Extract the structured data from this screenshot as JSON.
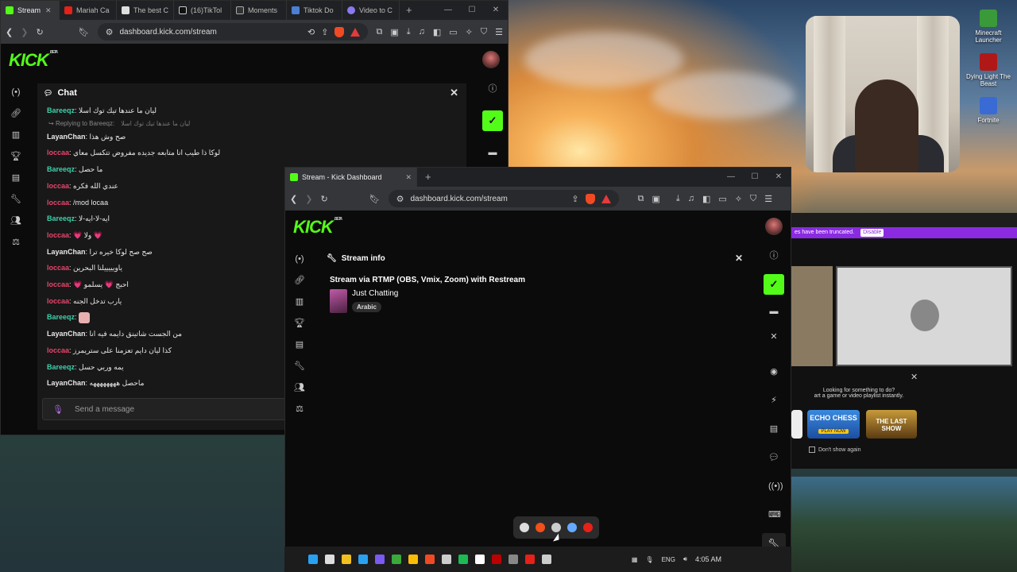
{
  "desktop": {
    "icons": [
      {
        "label": "Minecraft Launcher",
        "color": "#3a9a3a"
      },
      {
        "label": "Dying Light The Beast",
        "color": "#b01818"
      },
      {
        "label": "Fortnite",
        "color": "#3a6ad4"
      }
    ]
  },
  "back_window": {
    "banner_text": "es have been truncated.",
    "banner_button": "Disable",
    "suggest_line1": "Looking for something to do?",
    "suggest_line2": "art a game or video playlist instantly.",
    "game1": "ECHO CHESS",
    "game1_sub": "PLAY NOW",
    "game2": "THE LAST SHOW",
    "dont_show": "Don't show again"
  },
  "win1": {
    "tabs": [
      {
        "label": "Stream",
        "color": "#53fc18",
        "active": true
      },
      {
        "label": "Mariah Ca",
        "color": "#e62117"
      },
      {
        "label": "The best C",
        "color": "#dddddd"
      },
      {
        "label": "(16)TikTol",
        "color": "#111111"
      },
      {
        "label": "Moments",
        "color": "#333333"
      },
      {
        "label": "Tiktok Do",
        "color": "#4a7fd4"
      },
      {
        "label": "Video to C",
        "color": "#8a7af0"
      }
    ],
    "url": "dashboard.kick.com/stream",
    "logo": "KICK",
    "beta": "BETA",
    "chat": {
      "title": "Chat",
      "messages": [
        {
          "user": "Bareeqz",
          "color": "#3fd0a8",
          "text": "ليان ما عندها تيك توك اسلا"
        },
        {
          "reply_to": "Replying to Bareeqz:",
          "reply_text": "ليان ما عندها تيك توك اسلا"
        },
        {
          "user": "LayanChan",
          "color": "#e8e8e8",
          "text": "صح وش هذا"
        },
        {
          "user": "loccaa",
          "color": "#e8446a",
          "text": "لوكا ذا طيب انا متابعه جديده مفروض تتكسل معاي"
        },
        {
          "user": "Bareeqz",
          "color": "#3fd0a8",
          "text": "ما حصل"
        },
        {
          "user": "loccaa",
          "color": "#e8446a",
          "text": "عندي الله فكره"
        },
        {
          "user": "loccaa",
          "color": "#e8446a",
          "text": "/mod locaa"
        },
        {
          "user": "Bareeqz",
          "color": "#3fd0a8",
          "text": "ايه-لا-ايه-لا"
        },
        {
          "user": "loccaa",
          "color": "#e8446a",
          "text": "💗 ولا 💗"
        },
        {
          "user": "LayanChan",
          "color": "#e8e8e8",
          "text": "صح صح لوكا خيره ترا"
        },
        {
          "user": "loccaa",
          "color": "#e8446a",
          "text": "ياويييييلنا البحرين"
        },
        {
          "user": "loccaa",
          "color": "#e8446a",
          "text": "💗 احبج 💗 يسلمو"
        },
        {
          "user": "loccaa",
          "color": "#e8446a",
          "text": "يارب تدخل الجنه"
        },
        {
          "user": "Bareeqz",
          "color": "#3fd0a8",
          "text": ""
        },
        {
          "user": "LayanChan",
          "color": "#e8e8e8",
          "text": "من الجست شاتينق دايمه فيه انا"
        },
        {
          "user": "loccaa",
          "color": "#e8446a",
          "text": "كذا ليان دايم تعزمنا على ستريمرز"
        },
        {
          "user": "Bareeqz",
          "color": "#3fd0a8",
          "text": "يمه وربي حسل"
        },
        {
          "user": "LayanChan",
          "color": "#e8e8e8",
          "text": "ماحصل ههههههههه"
        }
      ],
      "placeholder": "Send a message"
    }
  },
  "win2": {
    "tab_label": "Stream - Kick Dashboard",
    "new_tab": "+",
    "url": "dashboard.kick.com/stream",
    "logo": "KICK",
    "beta": "BETA",
    "stream_info": {
      "title": "Stream info",
      "method": "Stream via RTMP (OBS, Vmix, Zoom) with Restream",
      "category": "Just Chatting",
      "tag": "Arabic"
    }
  },
  "taskbar": {
    "lang": "ENG",
    "time": "4:05 AM",
    "icons": [
      "#2aa0f0",
      "#dddddd",
      "#f0c020",
      "#2aa0f0",
      "#7a5af0",
      "#3aaa3a",
      "#fbbc05",
      "#f04a24",
      "#cccccc",
      "#1db954",
      "#ffffff",
      "#b00",
      "#888888",
      "#e62117",
      "#cccccc"
    ],
    "tray_popup": [
      "#dddddd",
      "#f0501a",
      "#cccccc",
      "#66aaff",
      "#e62117"
    ]
  }
}
